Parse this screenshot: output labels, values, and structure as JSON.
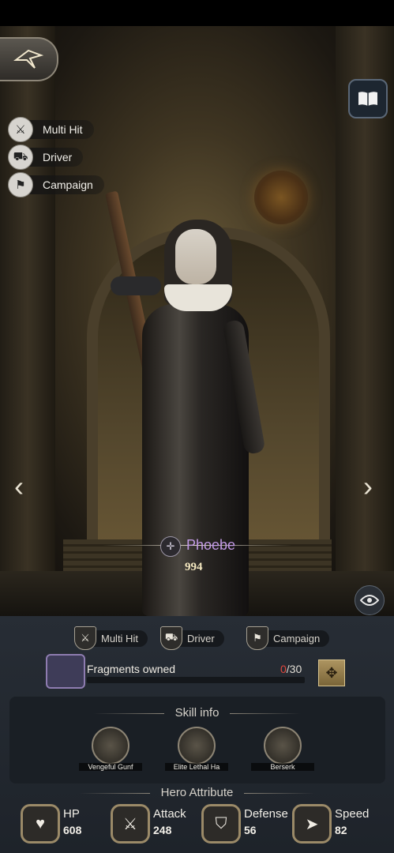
{
  "top_buttons": {
    "emblem_icon": "crossbow-emblem-icon",
    "book_icon": "book-icon"
  },
  "tags": [
    {
      "icon": "sword-hit-icon",
      "label": "Multi Hit"
    },
    {
      "icon": "vehicle-icon",
      "label": "Driver"
    },
    {
      "icon": "flag-icon",
      "label": "Campaign"
    }
  ],
  "nav": {
    "prev": "‹",
    "next": "›"
  },
  "hero": {
    "name": "Phoebe",
    "power": "994",
    "class_icon": "crossbow-icon",
    "name_color": "#c39be6"
  },
  "panel": {
    "chips": [
      {
        "icon": "sword-hit-icon",
        "label": "Multi Hit"
      },
      {
        "icon": "vehicle-icon",
        "label": "Driver"
      },
      {
        "icon": "flag-icon",
        "label": "Campaign"
      }
    ],
    "fragments": {
      "label": "Fragments owned",
      "owned": "0",
      "required": "/30",
      "progress": 0
    },
    "skill_title": "Skill info",
    "skills": [
      {
        "name": "Vengeful Gunf"
      },
      {
        "name": "Elite Lethal Ha"
      },
      {
        "name": "Berserk"
      }
    ],
    "attr_title": "Hero Attribute",
    "attributes": [
      {
        "icon": "heart-icon",
        "name": "HP",
        "value": "608"
      },
      {
        "icon": "crossed-swords-icon",
        "name": "Attack",
        "value": "248"
      },
      {
        "icon": "shield-icon",
        "name": "Defense",
        "value": "56"
      },
      {
        "icon": "boot-icon",
        "name": "Speed",
        "value": "82"
      }
    ]
  }
}
